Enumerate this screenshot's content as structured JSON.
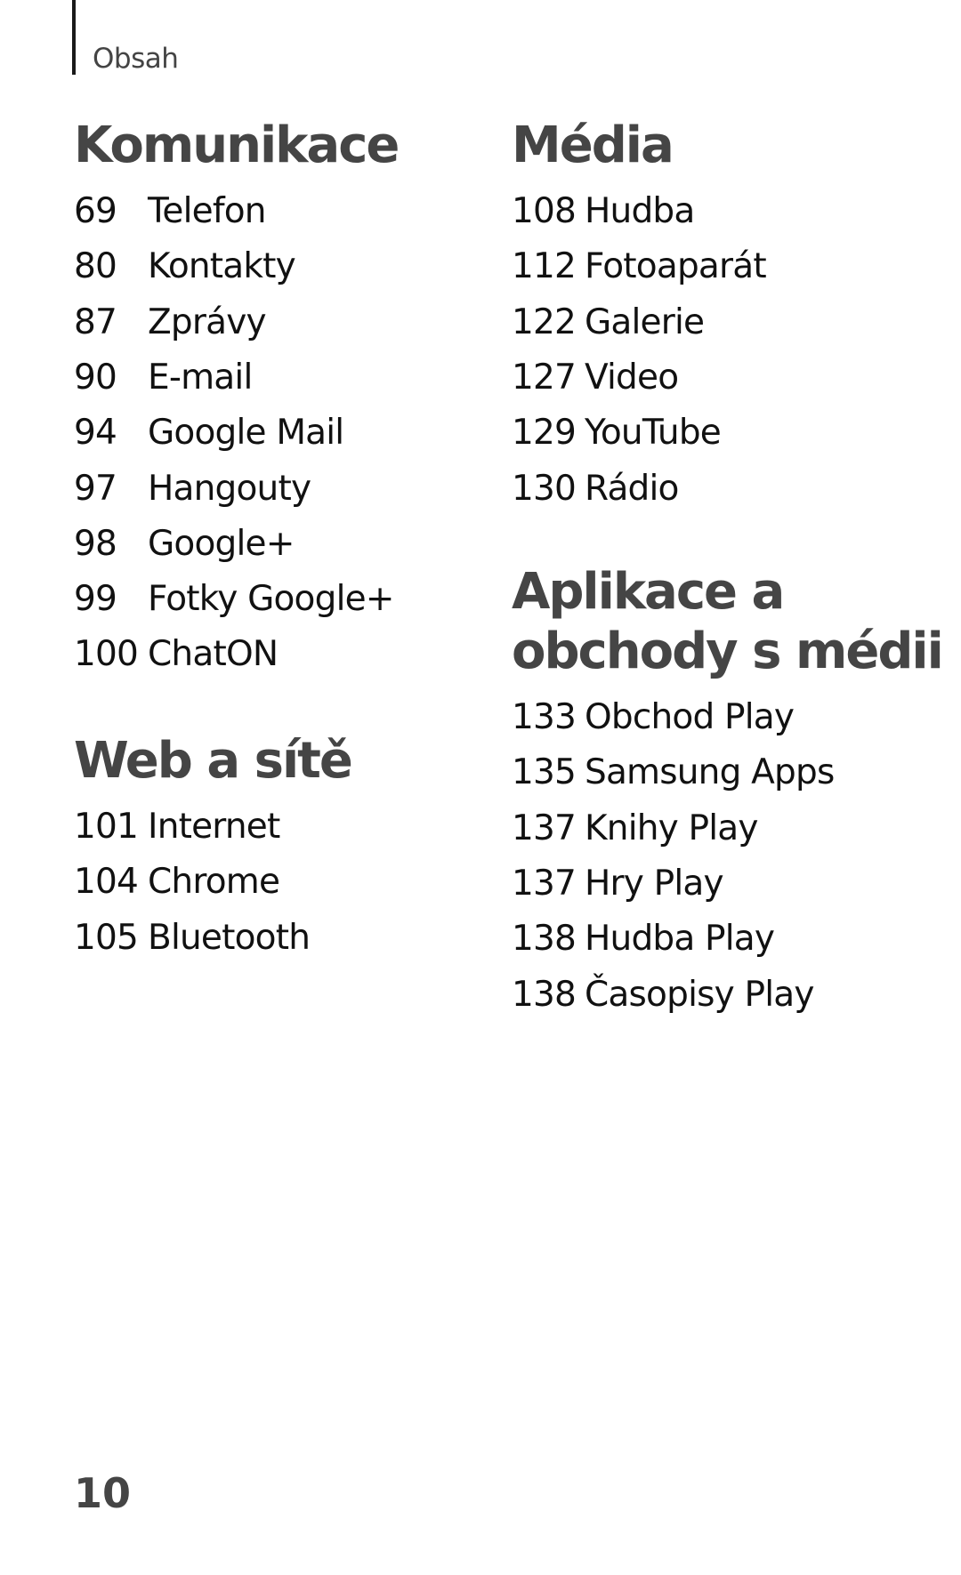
{
  "header": {
    "title": "Obsah"
  },
  "sections": {
    "komunikace": {
      "title": "Komunikace",
      "items": [
        {
          "page": "69",
          "label": "Telefon"
        },
        {
          "page": "80",
          "label": "Kontakty"
        },
        {
          "page": "87",
          "label": "Zprávy"
        },
        {
          "page": "90",
          "label": "E-mail"
        },
        {
          "page": "94",
          "label": "Google Mail"
        },
        {
          "page": "97",
          "label": "Hangouty"
        },
        {
          "page": "98",
          "label": "Google+"
        },
        {
          "page": "99",
          "label": "Fotky Google+"
        },
        {
          "page": "100",
          "label": "ChatON"
        }
      ]
    },
    "web": {
      "title": "Web a sítě",
      "items": [
        {
          "page": "101",
          "label": "Internet"
        },
        {
          "page": "104",
          "label": "Chrome"
        },
        {
          "page": "105",
          "label": "Bluetooth"
        }
      ]
    },
    "media": {
      "title": "Média",
      "items": [
        {
          "page": "108",
          "label": "Hudba"
        },
        {
          "page": "112",
          "label": "Fotoaparát"
        },
        {
          "page": "122",
          "label": "Galerie"
        },
        {
          "page": "127",
          "label": "Video"
        },
        {
          "page": "129",
          "label": "YouTube"
        },
        {
          "page": "130",
          "label": "Rádio"
        }
      ]
    },
    "aplikace": {
      "title_line1": "Aplikace a",
      "title_line2": "obchody s médii",
      "items": [
        {
          "page": "133",
          "label": "Obchod Play"
        },
        {
          "page": "135",
          "label": "Samsung Apps"
        },
        {
          "page": "137",
          "label": "Knihy Play"
        },
        {
          "page": "137",
          "label": "Hry Play"
        },
        {
          "page": "138",
          "label": "Hudba Play"
        },
        {
          "page": "138",
          "label": "Časopisy Play"
        }
      ]
    }
  },
  "footer": {
    "page_number": "10"
  }
}
